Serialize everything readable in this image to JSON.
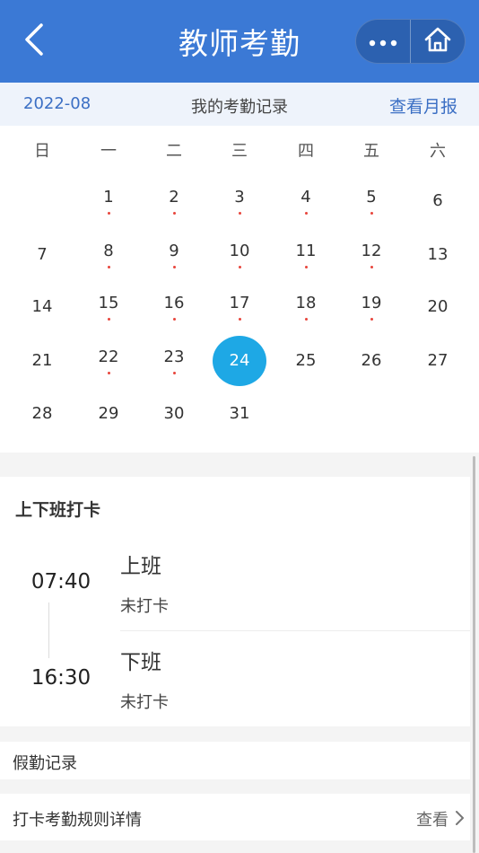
{
  "header": {
    "title": "教师考勤",
    "back_icon": "chevron-left-icon",
    "more_icon": "more-dots-icon",
    "home_icon": "home-icon",
    "color": "#3b79d5"
  },
  "subheader": {
    "month": "2022-08",
    "title": "我的考勤记录",
    "monthly_report": "查看月报"
  },
  "calendar": {
    "weekdays": [
      "日",
      "一",
      "二",
      "三",
      "四",
      "五",
      "六"
    ],
    "weeks": [
      [
        {
          "d": ""
        },
        {
          "d": "1",
          "mark": true
        },
        {
          "d": "2",
          "mark": true
        },
        {
          "d": "3",
          "mark": true
        },
        {
          "d": "4",
          "mark": true
        },
        {
          "d": "5",
          "mark": true
        },
        {
          "d": "6"
        }
      ],
      [
        {
          "d": "7"
        },
        {
          "d": "8",
          "mark": true
        },
        {
          "d": "9",
          "mark": true
        },
        {
          "d": "10",
          "mark": true
        },
        {
          "d": "11",
          "mark": true
        },
        {
          "d": "12",
          "mark": true
        },
        {
          "d": "13"
        }
      ],
      [
        {
          "d": "14"
        },
        {
          "d": "15",
          "mark": true
        },
        {
          "d": "16",
          "mark": true
        },
        {
          "d": "17",
          "mark": true
        },
        {
          "d": "18",
          "mark": true
        },
        {
          "d": "19",
          "mark": true
        },
        {
          "d": "20"
        }
      ],
      [
        {
          "d": "21"
        },
        {
          "d": "22",
          "mark": true
        },
        {
          "d": "23",
          "mark": true
        },
        {
          "d": "24",
          "selected": true
        },
        {
          "d": "25"
        },
        {
          "d": "26"
        },
        {
          "d": "27"
        }
      ],
      [
        {
          "d": "28"
        },
        {
          "d": "29"
        },
        {
          "d": "30"
        },
        {
          "d": "31"
        },
        {
          "d": ""
        },
        {
          "d": ""
        },
        {
          "d": ""
        }
      ]
    ],
    "selected_color": "#1ea8e5",
    "mark_color": "#e8453c"
  },
  "punch": {
    "title": "上下班打卡",
    "on_duty": {
      "time": "07:40",
      "label": "上班",
      "status": "未打卡"
    },
    "off_duty": {
      "time": "16:30",
      "label": "下班",
      "status": "未打卡"
    }
  },
  "leave": {
    "label": "假勤记录"
  },
  "rules": {
    "label": "打卡考勤规则详情",
    "action": "查看",
    "icon": "chevron-right-icon"
  }
}
